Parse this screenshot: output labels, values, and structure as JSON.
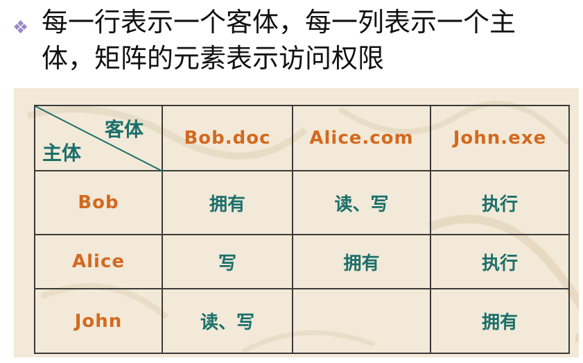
{
  "heading": {
    "bullet_icon": "diamond-cluster-bullet-icon",
    "line1": "每一行表示一个客体，每一列表示一个主",
    "line2": "体，矩阵的元素表示访问权限"
  },
  "matrix": {
    "corner": {
      "object_label": "客体",
      "subject_label": "主体"
    },
    "columns": [
      "Bob.doc",
      "Alice.com",
      "John.exe"
    ],
    "rows": [
      {
        "subject": "Bob",
        "cells": [
          "拥有",
          "读、写",
          "执行"
        ]
      },
      {
        "subject": "Alice",
        "cells": [
          "写",
          "拥有",
          "执行"
        ]
      },
      {
        "subject": "John",
        "cells": [
          "读、写",
          "",
          "拥有"
        ]
      }
    ]
  },
  "colors": {
    "header_text": "#d3691f",
    "cell_text": "#1a6f6b",
    "panel_bg": "#f2e9d8",
    "bullet": "#9a88c8"
  }
}
